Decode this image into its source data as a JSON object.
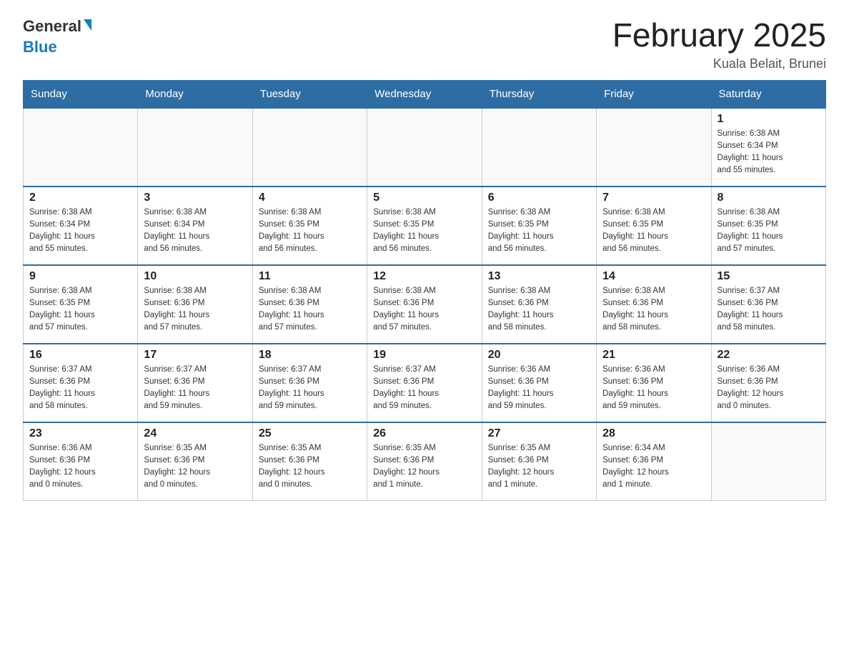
{
  "logo": {
    "text_general": "General",
    "text_blue": "Blue"
  },
  "title": "February 2025",
  "location": "Kuala Belait, Brunei",
  "days_of_week": [
    "Sunday",
    "Monday",
    "Tuesday",
    "Wednesday",
    "Thursday",
    "Friday",
    "Saturday"
  ],
  "weeks": [
    [
      {
        "day": "",
        "info": ""
      },
      {
        "day": "",
        "info": ""
      },
      {
        "day": "",
        "info": ""
      },
      {
        "day": "",
        "info": ""
      },
      {
        "day": "",
        "info": ""
      },
      {
        "day": "",
        "info": ""
      },
      {
        "day": "1",
        "info": "Sunrise: 6:38 AM\nSunset: 6:34 PM\nDaylight: 11 hours\nand 55 minutes."
      }
    ],
    [
      {
        "day": "2",
        "info": "Sunrise: 6:38 AM\nSunset: 6:34 PM\nDaylight: 11 hours\nand 55 minutes."
      },
      {
        "day": "3",
        "info": "Sunrise: 6:38 AM\nSunset: 6:34 PM\nDaylight: 11 hours\nand 56 minutes."
      },
      {
        "day": "4",
        "info": "Sunrise: 6:38 AM\nSunset: 6:35 PM\nDaylight: 11 hours\nand 56 minutes."
      },
      {
        "day": "5",
        "info": "Sunrise: 6:38 AM\nSunset: 6:35 PM\nDaylight: 11 hours\nand 56 minutes."
      },
      {
        "day": "6",
        "info": "Sunrise: 6:38 AM\nSunset: 6:35 PM\nDaylight: 11 hours\nand 56 minutes."
      },
      {
        "day": "7",
        "info": "Sunrise: 6:38 AM\nSunset: 6:35 PM\nDaylight: 11 hours\nand 56 minutes."
      },
      {
        "day": "8",
        "info": "Sunrise: 6:38 AM\nSunset: 6:35 PM\nDaylight: 11 hours\nand 57 minutes."
      }
    ],
    [
      {
        "day": "9",
        "info": "Sunrise: 6:38 AM\nSunset: 6:35 PM\nDaylight: 11 hours\nand 57 minutes."
      },
      {
        "day": "10",
        "info": "Sunrise: 6:38 AM\nSunset: 6:36 PM\nDaylight: 11 hours\nand 57 minutes."
      },
      {
        "day": "11",
        "info": "Sunrise: 6:38 AM\nSunset: 6:36 PM\nDaylight: 11 hours\nand 57 minutes."
      },
      {
        "day": "12",
        "info": "Sunrise: 6:38 AM\nSunset: 6:36 PM\nDaylight: 11 hours\nand 57 minutes."
      },
      {
        "day": "13",
        "info": "Sunrise: 6:38 AM\nSunset: 6:36 PM\nDaylight: 11 hours\nand 58 minutes."
      },
      {
        "day": "14",
        "info": "Sunrise: 6:38 AM\nSunset: 6:36 PM\nDaylight: 11 hours\nand 58 minutes."
      },
      {
        "day": "15",
        "info": "Sunrise: 6:37 AM\nSunset: 6:36 PM\nDaylight: 11 hours\nand 58 minutes."
      }
    ],
    [
      {
        "day": "16",
        "info": "Sunrise: 6:37 AM\nSunset: 6:36 PM\nDaylight: 11 hours\nand 58 minutes."
      },
      {
        "day": "17",
        "info": "Sunrise: 6:37 AM\nSunset: 6:36 PM\nDaylight: 11 hours\nand 59 minutes."
      },
      {
        "day": "18",
        "info": "Sunrise: 6:37 AM\nSunset: 6:36 PM\nDaylight: 11 hours\nand 59 minutes."
      },
      {
        "day": "19",
        "info": "Sunrise: 6:37 AM\nSunset: 6:36 PM\nDaylight: 11 hours\nand 59 minutes."
      },
      {
        "day": "20",
        "info": "Sunrise: 6:36 AM\nSunset: 6:36 PM\nDaylight: 11 hours\nand 59 minutes."
      },
      {
        "day": "21",
        "info": "Sunrise: 6:36 AM\nSunset: 6:36 PM\nDaylight: 11 hours\nand 59 minutes."
      },
      {
        "day": "22",
        "info": "Sunrise: 6:36 AM\nSunset: 6:36 PM\nDaylight: 12 hours\nand 0 minutes."
      }
    ],
    [
      {
        "day": "23",
        "info": "Sunrise: 6:36 AM\nSunset: 6:36 PM\nDaylight: 12 hours\nand 0 minutes."
      },
      {
        "day": "24",
        "info": "Sunrise: 6:35 AM\nSunset: 6:36 PM\nDaylight: 12 hours\nand 0 minutes."
      },
      {
        "day": "25",
        "info": "Sunrise: 6:35 AM\nSunset: 6:36 PM\nDaylight: 12 hours\nand 0 minutes."
      },
      {
        "day": "26",
        "info": "Sunrise: 6:35 AM\nSunset: 6:36 PM\nDaylight: 12 hours\nand 1 minute."
      },
      {
        "day": "27",
        "info": "Sunrise: 6:35 AM\nSunset: 6:36 PM\nDaylight: 12 hours\nand 1 minute."
      },
      {
        "day": "28",
        "info": "Sunrise: 6:34 AM\nSunset: 6:36 PM\nDaylight: 12 hours\nand 1 minute."
      },
      {
        "day": "",
        "info": ""
      }
    ]
  ]
}
